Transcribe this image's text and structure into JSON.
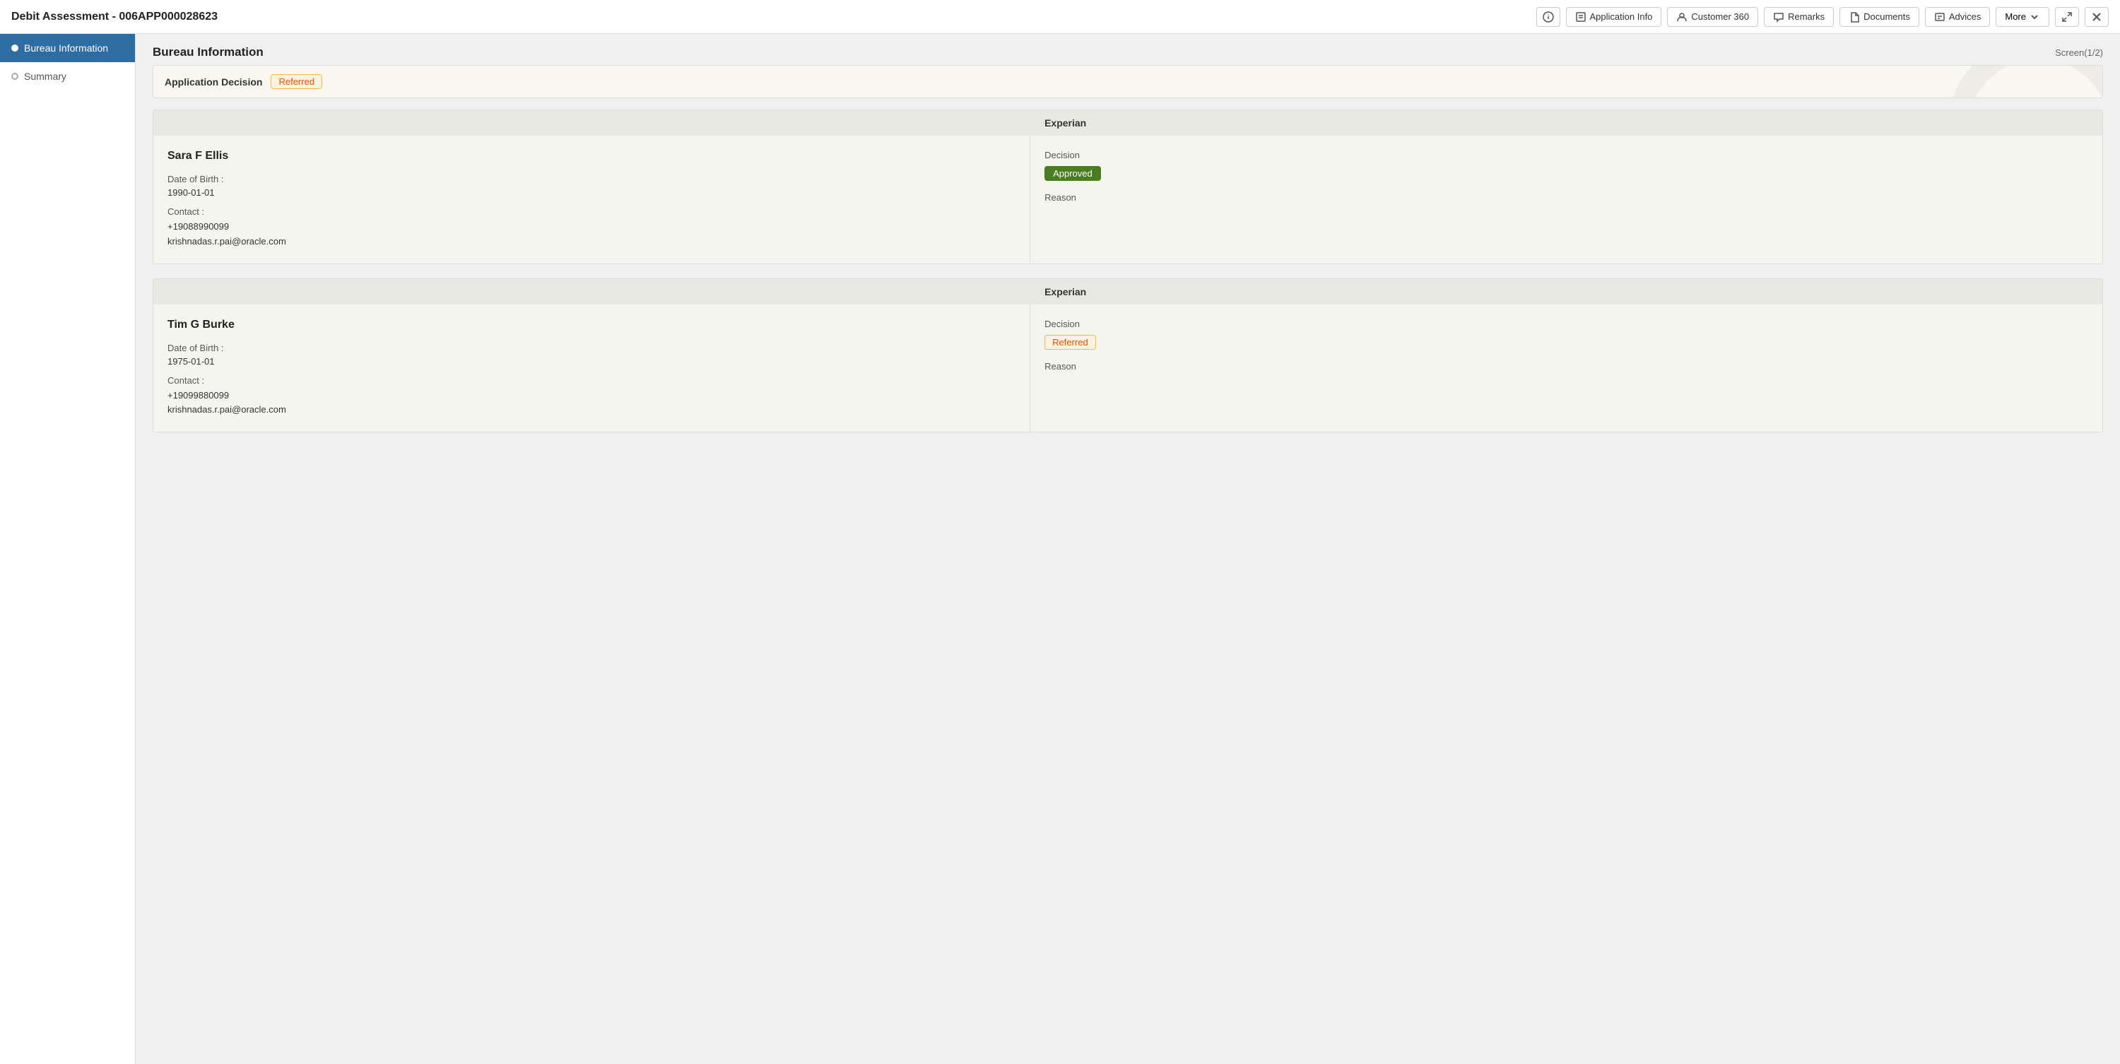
{
  "header": {
    "title": "Debit Assessment - 006APP000028623",
    "buttons": {
      "info": "ℹ",
      "application_info": "Application Info",
      "customer_360": "Customer 360",
      "remarks": "Remarks",
      "documents": "Documents",
      "advices": "Advices",
      "more": "More"
    }
  },
  "sidebar": {
    "items": [
      {
        "id": "bureau-information",
        "label": "Bureau Information",
        "active": true
      },
      {
        "id": "summary",
        "label": "Summary",
        "active": false
      }
    ]
  },
  "main": {
    "title": "Bureau Information",
    "screen_info": "Screen(1/2)",
    "decision_bar": {
      "label": "Application Decision",
      "badge": "Referred"
    },
    "cards": [
      {
        "id": "card-sara",
        "column_header": "Experian",
        "person_name": "Sara F Ellis",
        "dob_label": "Date of Birth :",
        "dob_value": "1990-01-01",
        "contact_label": "Contact :",
        "contact_phone": "+19088990099",
        "contact_email": "krishnadas.r.pai@oracle.com",
        "decision_label": "Decision",
        "decision_badge": "Approved",
        "decision_badge_type": "approved",
        "reason_label": "Reason",
        "reason_value": ""
      },
      {
        "id": "card-tim",
        "column_header": "Experian",
        "person_name": "Tim G Burke",
        "dob_label": "Date of Birth :",
        "dob_value": "1975-01-01",
        "contact_label": "Contact :",
        "contact_phone": "+19099880099",
        "contact_email": "krishnadas.r.pai@oracle.com",
        "decision_label": "Decision",
        "decision_badge": "Referred",
        "decision_badge_type": "referred",
        "reason_label": "Reason",
        "reason_value": ""
      }
    ]
  }
}
